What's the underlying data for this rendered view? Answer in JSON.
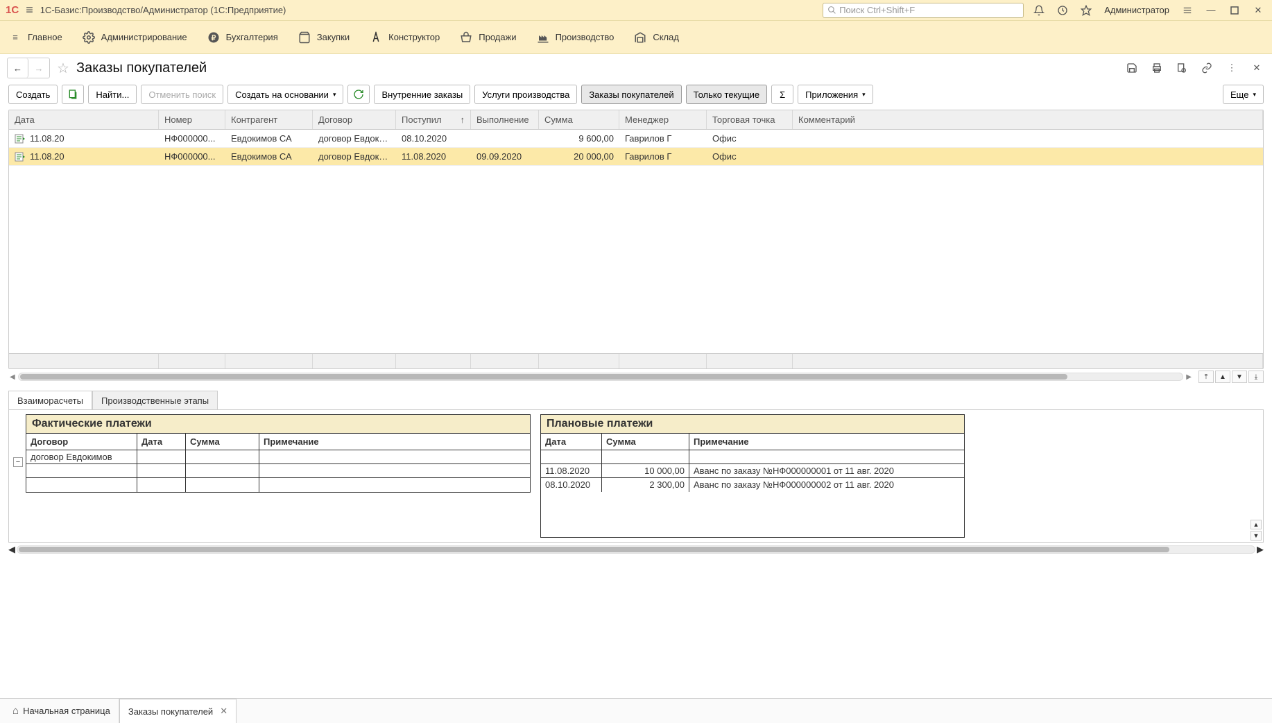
{
  "sysbar": {
    "logo": "1C",
    "title": "1С-Базис:Производство/Администратор  (1С:Предприятие)",
    "search_placeholder": "Поиск Ctrl+Shift+F",
    "user": "Администратор"
  },
  "menu": {
    "items": [
      {
        "label": "Главное"
      },
      {
        "label": "Администрирование"
      },
      {
        "label": "Бухгалтерия"
      },
      {
        "label": "Закупки"
      },
      {
        "label": "Конструктор"
      },
      {
        "label": "Продажи"
      },
      {
        "label": "Производство"
      },
      {
        "label": "Склад"
      }
    ]
  },
  "page": {
    "title": "Заказы покупателей"
  },
  "toolbar": {
    "create": "Создать",
    "find": "Найти...",
    "cancel_search": "Отменить поиск",
    "create_based": "Создать на основании",
    "internal": "Внутренние заказы",
    "services": "Услуги производства",
    "buyer_orders": "Заказы покупателей",
    "current_only": "Только текущие",
    "attachments": "Приложения",
    "more": "Еще"
  },
  "table": {
    "columns": {
      "date": "Дата",
      "number": "Номер",
      "contractor": "Контрагент",
      "contract": "Договор",
      "received": "Поступил",
      "done": "Выполнение",
      "sum": "Сумма",
      "manager": "Менеджер",
      "point": "Торговая точка",
      "comment": "Комментарий"
    },
    "rows": [
      {
        "date": "11.08.20",
        "num": "НФ000000...",
        "ka": "Евдокимов СА",
        "dog": "договор Евдоки...",
        "post": "08.10.2020",
        "vyp": "",
        "sum": "9 600,00",
        "man": "Гаврилов Г",
        "tt": "Офис",
        "com": ""
      },
      {
        "date": "11.08.20",
        "num": "НФ000000...",
        "ka": "Евдокимов СА",
        "dog": "договор Евдоки...",
        "post": "11.08.2020",
        "vyp": "09.09.2020",
        "sum": "20 000,00",
        "man": "Гаврилов Г",
        "tt": "Офис",
        "com": ""
      }
    ]
  },
  "tabs": {
    "settlements": "Взаиморасчеты",
    "stages": "Производственные этапы"
  },
  "left_sub": {
    "title": "Фактические платежи",
    "cols": {
      "c1": "Договор",
      "c2": "Дата",
      "c3": "Сумма",
      "c4": "Примечание"
    },
    "rows": [
      {
        "c1": "договор Евдокимов",
        "c2": "",
        "c3": "",
        "c4": ""
      },
      {
        "c1": "",
        "c2": "",
        "c3": "",
        "c4": ""
      },
      {
        "c1": "",
        "c2": "",
        "c3": "",
        "c4": ""
      }
    ]
  },
  "right_sub": {
    "title": "Плановые платежи",
    "cols": {
      "c1": "Дата",
      "c2": "Сумма",
      "c3": "Примечание"
    },
    "rows": [
      {
        "c1": "",
        "c2": "",
        "c3": ""
      },
      {
        "c1": "11.08.2020",
        "c2": "10 000,00",
        "c3": "Аванс по заказу №НФ000000001 от 11 авг. 2020"
      },
      {
        "c1": "08.10.2020",
        "c2": "2 300,00",
        "c3": "Аванс по заказу №НФ000000002 от 11 авг. 2020"
      }
    ]
  },
  "bottom_tabs": {
    "home": "Начальная страница",
    "orders": "Заказы покупателей"
  }
}
